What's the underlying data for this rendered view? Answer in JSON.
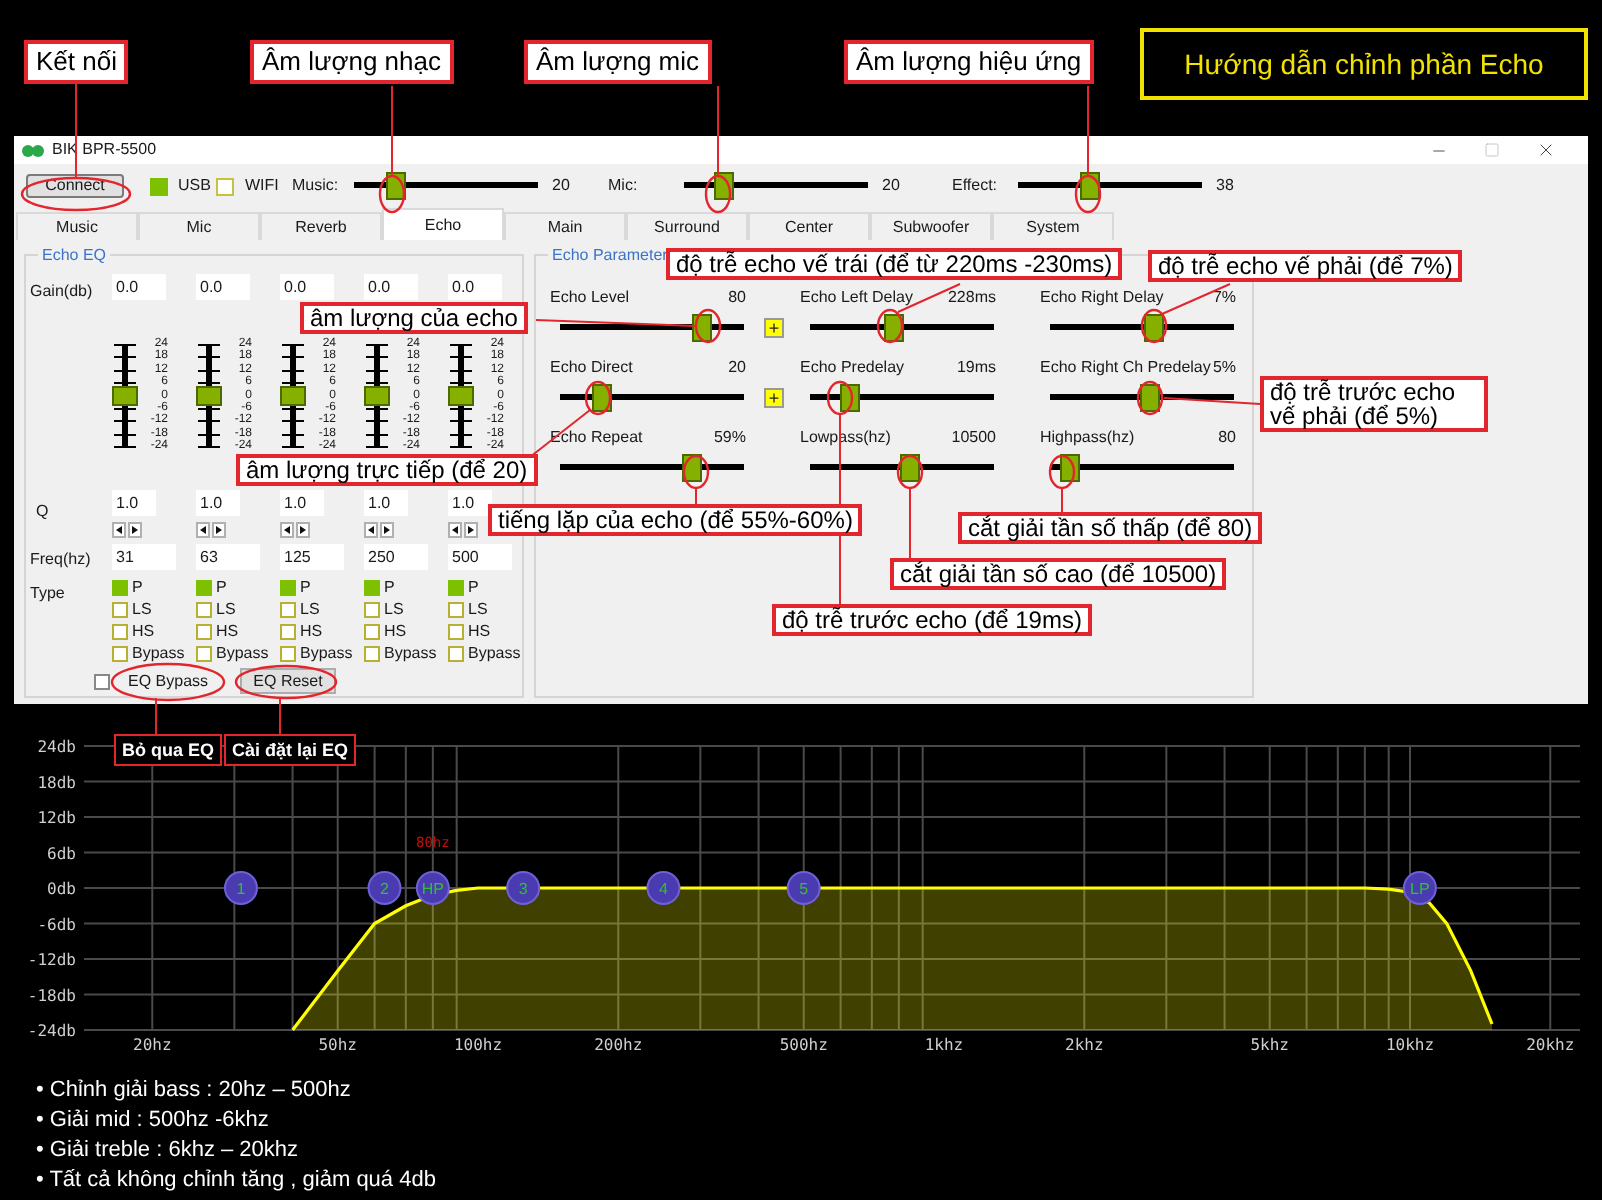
{
  "guide_title": "Hướng dẫn chỉnh phần Echo",
  "callouts": [
    {
      "text": "Kết nối",
      "kind": "top"
    },
    {
      "text": "Âm lượng nhạc",
      "kind": "top"
    },
    {
      "text": "Âm lượng mic",
      "kind": "top"
    },
    {
      "text": "Âm lượng hiệu ứng",
      "kind": "top"
    },
    {
      "text": "âm lượng của echo",
      "kind": "note"
    },
    {
      "text": "độ trễ echo vế trái (để từ 220ms -230ms)",
      "kind": "note"
    },
    {
      "text": "độ trễ echo vế phải (để 7%)",
      "kind": "note"
    },
    {
      "text": "độ trễ trước echo vế phải (để 5%)",
      "kind": "note"
    },
    {
      "text": "âm lượng trực tiếp (để 20)",
      "kind": "note"
    },
    {
      "text": "tiếng lặp của echo (để 55%-60%)",
      "kind": "note"
    },
    {
      "text": "cắt giải tần số thấp (để 80)",
      "kind": "note"
    },
    {
      "text": "cắt giải tần số cao (để 10500)",
      "kind": "note"
    },
    {
      "text": "độ trễ trước echo (để 19ms)",
      "kind": "note"
    },
    {
      "text": "Bỏ qua EQ",
      "kind": "dark"
    },
    {
      "text": "Cài đặt lại EQ",
      "kind": "dark"
    }
  ],
  "window": {
    "title": "BIK BPR-5500"
  },
  "toolbar": {
    "connect": "Connect",
    "checkboxes": [
      {
        "label": "USB",
        "checked": true
      },
      {
        "label": "WIFI",
        "checked": false
      }
    ],
    "sliders": [
      {
        "label": "Music:",
        "level": 0.2,
        "reading": "20"
      },
      {
        "label": "Mic:",
        "level": 0.18,
        "reading": "20"
      },
      {
        "label": "Effect:",
        "level": 0.38,
        "reading": "38"
      }
    ]
  },
  "tabs": [
    {
      "label": "Music",
      "selected": false
    },
    {
      "label": "Mic",
      "selected": false
    },
    {
      "label": "Reverb",
      "selected": false
    },
    {
      "label": "Echo",
      "selected": true
    },
    {
      "label": "Main",
      "selected": false
    },
    {
      "label": "Surround",
      "selected": false
    },
    {
      "label": "Center",
      "selected": false
    },
    {
      "label": "Subwoofer",
      "selected": false
    },
    {
      "label": "System",
      "selected": false
    }
  ],
  "echo_eq": {
    "title": "Echo EQ",
    "row_labels": [
      "Gain(db)",
      "Q",
      "Freq(hz)",
      "Type"
    ],
    "bands": [
      {
        "gain": "0.0",
        "level": 0.5,
        "scale": [
          "24",
          "18",
          "12",
          "6",
          "0",
          "-6",
          "-12",
          "-18",
          "-24"
        ],
        "q": "1.0",
        "freq": "31",
        "types": [
          {
            "label": "P",
            "selected": true
          },
          {
            "label": "LS",
            "selected": false
          },
          {
            "label": "HS",
            "selected": false
          },
          {
            "label": "Bypass",
            "selected": false
          }
        ]
      },
      {
        "gain": "0.0",
        "level": 0.5,
        "scale": [
          "24",
          "18",
          "12",
          "6",
          "0",
          "-6",
          "-12",
          "-18",
          "-24"
        ],
        "q": "1.0",
        "freq": "63",
        "types": [
          {
            "label": "P",
            "selected": true
          },
          {
            "label": "LS",
            "selected": false
          },
          {
            "label": "HS",
            "selected": false
          },
          {
            "label": "Bypass",
            "selected": false
          }
        ]
      },
      {
        "gain": "0.0",
        "level": 0.5,
        "scale": [
          "24",
          "18",
          "12",
          "6",
          "0",
          "-6",
          "-12",
          "-18",
          "-24"
        ],
        "q": "1.0",
        "freq": "125",
        "types": [
          {
            "label": "P",
            "selected": true
          },
          {
            "label": "LS",
            "selected": false
          },
          {
            "label": "HS",
            "selected": false
          },
          {
            "label": "Bypass",
            "selected": false
          }
        ]
      },
      {
        "gain": "0.0",
        "level": 0.5,
        "scale": [
          "24",
          "18",
          "12",
          "6",
          "0",
          "-6",
          "-12",
          "-18",
          "-24"
        ],
        "q": "1.0",
        "freq": "250",
        "types": [
          {
            "label": "P",
            "selected": true
          },
          {
            "label": "LS",
            "selected": false
          },
          {
            "label": "HS",
            "selected": false
          },
          {
            "label": "Bypass",
            "selected": false
          }
        ]
      },
      {
        "gain": "0.0",
        "level": 0.5,
        "scale": [
          "24",
          "18",
          "12",
          "6",
          "0",
          "-6",
          "-12",
          "-18",
          "-24"
        ],
        "q": "1.0",
        "freq": "500",
        "types": [
          {
            "label": "P",
            "selected": true
          },
          {
            "label": "LS",
            "selected": false
          },
          {
            "label": "HS",
            "selected": false
          },
          {
            "label": "Bypass",
            "selected": false
          }
        ]
      }
    ],
    "bypass": {
      "label": "EQ Bypass",
      "checked": false
    },
    "reset": "EQ Reset"
  },
  "echo_parameter": {
    "title": "Echo Parameter",
    "params": [
      {
        "label": "Echo Level",
        "reading": "80",
        "level": 0.8,
        "plus": "+"
      },
      {
        "label": "Echo Left Delay",
        "reading": "228ms",
        "level": 0.45
      },
      {
        "label": "Echo Right Delay",
        "reading": "7%",
        "level": 0.57
      },
      {
        "label": "Echo Direct",
        "reading": "20",
        "level": 0.2,
        "plus": "+"
      },
      {
        "label": "Echo Predelay",
        "reading": "19ms",
        "level": 0.18
      },
      {
        "label": "Echo Right Ch Predelay",
        "reading": "5%",
        "level": 0.55
      },
      {
        "label": "Echo Repeat",
        "reading": "59%",
        "level": 0.74
      },
      {
        "label": "Lowpass(hz)",
        "reading": "10500",
        "level": 0.55
      },
      {
        "label": "Highpass(hz)",
        "reading": "80",
        "level": 0.06
      }
    ]
  },
  "graph": {
    "y_labels": [
      "24db",
      "18db",
      "12db",
      "6db",
      "0db",
      "-6db",
      "-12db",
      "-18db",
      "-24db"
    ],
    "x_labels": [
      "20hz",
      "50hz",
      "100hz",
      "200hz",
      "500hz",
      "1khz",
      "2khz",
      "5khz",
      "10khz",
      "20khz"
    ],
    "cutoff_label": "80hz",
    "markers": [
      {
        "text": "1"
      },
      {
        "text": "2"
      },
      {
        "text": "HP"
      },
      {
        "text": "3"
      },
      {
        "text": "4"
      },
      {
        "text": "5"
      },
      {
        "text": "LP"
      }
    ]
  },
  "notes": [
    "• Chỉnh giải bass : 20hz – 500hz",
    "• Giải mid : 500hz -6khz",
    "• Giải treble : 6khz – 20khz",
    "• Tất cả không chỉnh tăng , giảm quá 4db"
  ]
}
